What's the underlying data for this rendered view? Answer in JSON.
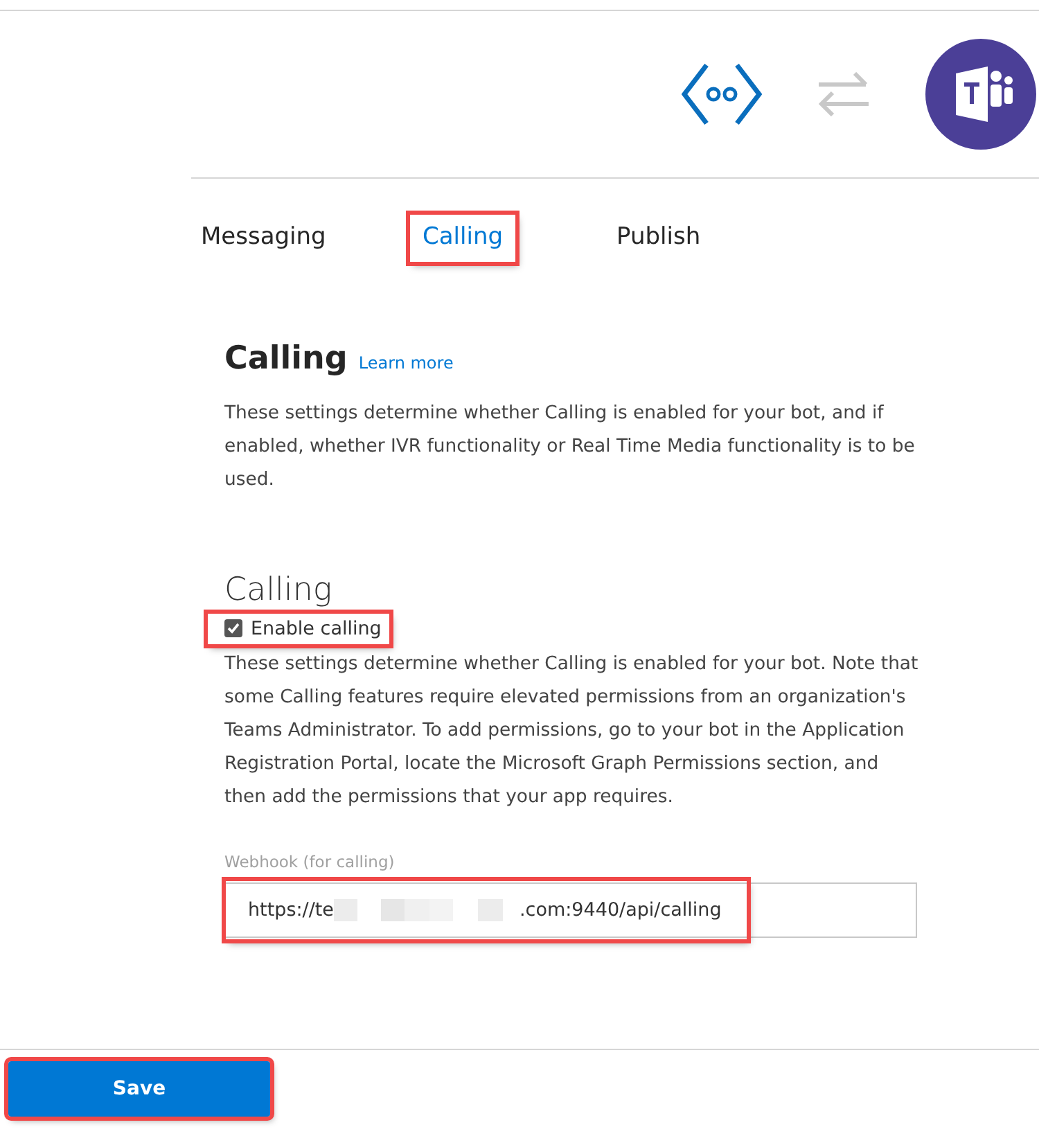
{
  "tabs": [
    {
      "label": "Messaging",
      "selected": false,
      "highlighted": false
    },
    {
      "label": "Calling",
      "selected": true,
      "highlighted": true
    },
    {
      "label": "Publish",
      "selected": false,
      "highlighted": false
    }
  ],
  "section": {
    "title": "Calling",
    "link": "Learn more",
    "description": "These settings determine whether Calling is enabled for your bot, and if enabled, whether IVR functionality or Real Time Media functionality is to be used."
  },
  "calling": {
    "heading": "Calling",
    "checkbox": {
      "label": "Enable calling",
      "checked": true,
      "highlighted": true
    },
    "note": "These settings determine whether Calling is enabled for your bot. Note that some Calling features require elevated permissions from an organization's Teams Administrator. To add permissions, go to your bot in the Application Registration Portal, locate the Microsoft Graph Permissions section, and then add the permissions that your app requires.",
    "webhook": {
      "label": "Webhook (for calling)",
      "value_start": "https://te",
      "value_end": ".com:9440/api/calling",
      "redacted": true,
      "highlighted": true
    }
  },
  "save_button": {
    "label": "Save",
    "highlighted": true
  }
}
